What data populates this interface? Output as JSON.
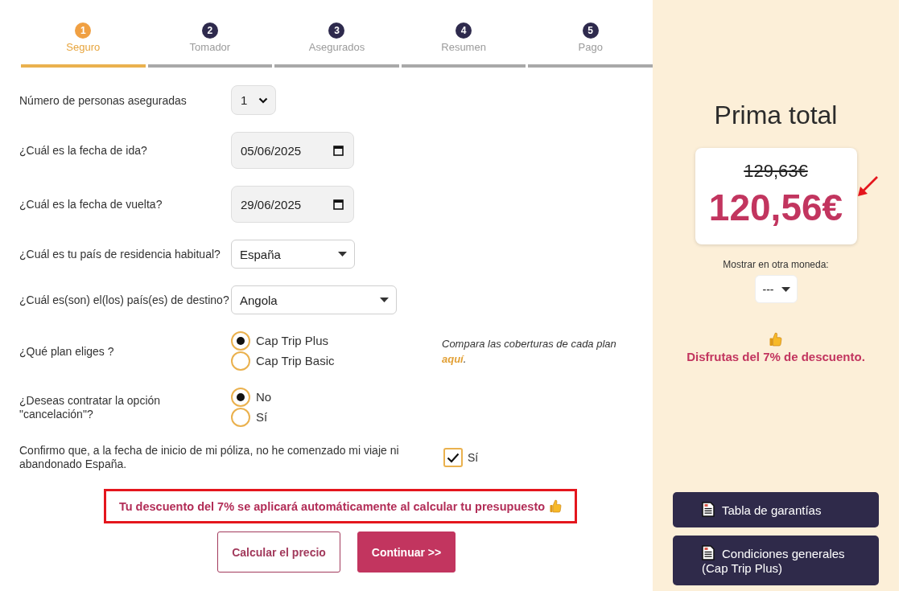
{
  "steps": [
    {
      "number": "1",
      "label": "Seguro",
      "selected": true
    },
    {
      "number": "2",
      "label": "Tomador",
      "selected": false
    },
    {
      "number": "3",
      "label": "Asegurados",
      "selected": false
    },
    {
      "number": "4",
      "label": "Resumen",
      "selected": false
    },
    {
      "number": "5",
      "label": "Pago",
      "selected": false
    }
  ],
  "form": {
    "rows": [
      {
        "kind": "count",
        "label": "Número de personas aseguradas",
        "value": "1"
      },
      {
        "kind": "date",
        "label": "¿Cuál es la fecha de ida?",
        "value": "05/06/2025"
      },
      {
        "kind": "date",
        "label": "¿Cuál es la fecha de vuelta?",
        "value": "29/06/2025"
      },
      {
        "kind": "select",
        "label": "¿Cuál es tu país de residencia habitual?",
        "value": "España"
      },
      {
        "kind": "select",
        "label": "¿Cuál es(son) el(los) país(es) de destino?",
        "value": "Angola"
      },
      {
        "kind": "radio",
        "label": "¿Qué plan eliges ?",
        "options": [
          {
            "label": "Cap Trip Plus",
            "selected": true
          },
          {
            "label": "Cap Trip Basic",
            "selected": false
          }
        ],
        "note": {
          "text": "Compara las coberturas de cada plan",
          "link": "aquí",
          "end": "."
        }
      },
      {
        "kind": "radio",
        "label": "¿Deseas contratar la opción \"cancelación\"?",
        "options": [
          {
            "label": "No",
            "selected": true
          },
          {
            "label": "Sí",
            "selected": false
          }
        ]
      },
      {
        "kind": "checkbox",
        "label": "Confirmo que, a la fecha de inicio de mi póliza, no he comenzado mi viaje ni abandonado España.",
        "option": "Sí",
        "checked": true
      }
    ],
    "notice": "Tu descuento del 7% se aplicará automáticamente al calcular tu presupuesto",
    "buttons": [
      {
        "kind": "secondary",
        "label": "Calcular el precio"
      },
      {
        "kind": "primary",
        "label": "Continuar >>"
      }
    ]
  },
  "summary": {
    "title": "Prima total",
    "old_price": "129,63€",
    "price": "120,56€",
    "currency_label": "Mostrar en otra moneda:",
    "currency_value": "---",
    "discount": "Disfrutas del 7% de descuento.",
    "documents": [
      {
        "label": "Tabla de garantías"
      },
      {
        "label": "Condiciones generales (Cap Trip Plus)"
      }
    ]
  }
}
